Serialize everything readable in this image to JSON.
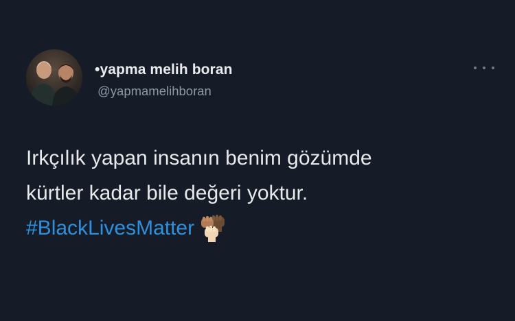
{
  "tweet": {
    "display_name": "•yapma melih boran",
    "handle": "@yapmamelihboran",
    "text_line_1": "Irkçılık yapan insanın benim gözümde",
    "text_line_2": "kürtler kadar bile değeri yoktur.",
    "hashtag": "#BlackLivesMatter",
    "emoji": "raised-fists-icon",
    "more_icon": "more-options-icon",
    "avatar_icon": "profile-photo"
  },
  "colors": {
    "background": "#151c27",
    "text": "#e7e9ea",
    "secondary_text": "#8b98a5",
    "link": "#2f8fdc"
  }
}
